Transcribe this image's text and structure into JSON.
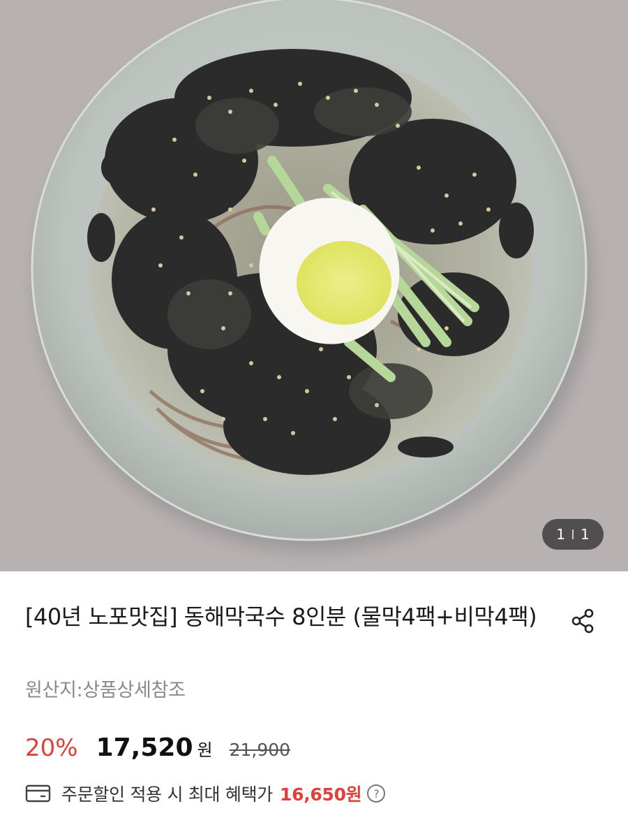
{
  "image_counter": {
    "current": "1",
    "total": "1"
  },
  "product": {
    "title": "[40년 노포맛집] 동해막국수 8인분 (물막4팩+비막4팩)",
    "origin": "원산지:상품상세참조",
    "discount_rate": "20%",
    "price": "17,520",
    "price_unit": "원",
    "original_price": "21,900",
    "benefit_text": "주문할인 적용 시 최대 혜택가",
    "benefit_price": "16,650원"
  },
  "colors": {
    "accent_red": "#e0403a",
    "photo_background": "#b9b3b4"
  },
  "icons": {
    "share": "share-icon",
    "card": "card-icon",
    "help": "help-icon"
  }
}
